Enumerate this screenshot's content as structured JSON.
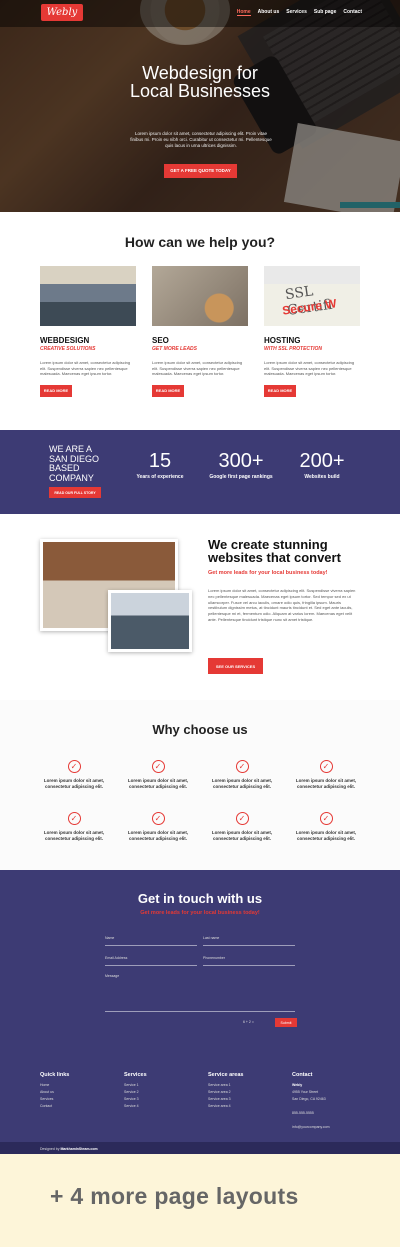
{
  "nav": {
    "logo": "Webly",
    "items": [
      "Home",
      "About us",
      "Services",
      "Sub page",
      "Contact"
    ]
  },
  "hero": {
    "title": "Webdesign for Local Businesses",
    "text": "Lorem ipsum dolor sit amet, consectetur adipiscing elit. Proin vitae finibus mi. Proin eu nibh orci. Curabitur ut consectetur mi. Pellentesque quis lacus in urna ultrices dignissim.",
    "button": "GET A FREE QUOTE TODAY"
  },
  "help": {
    "title": "How can we help you?",
    "cards": [
      {
        "title": "WEBDESIGN",
        "sub": "CREATIVE SOLUTIONS",
        "text": "Lorem ipsum dolor sit amet, consectetur adipiscing elit. Suspendisse viverra sapien nec pellentesque malesuada. Maecenas eget ipsum tortor.",
        "button": "READ MORE"
      },
      {
        "title": "SEO",
        "sub": "GET MORE LEADS",
        "text": "Lorem ipsum dolor sit amet, consectetur adipiscing elit. Suspendisse viverra sapien nec pellentesque malesuada. Maecenas eget ipsum tortor.",
        "button": "READ MORE"
      },
      {
        "title": "HOSTING",
        "sub": "WITH SSL PROTECTION",
        "text": "Lorem ipsum dolor sit amet, consectetur adipiscing elit. Suspendisse viverra sapien nec pellentesque malesuada. Maecenas eget ipsum tortor.",
        "button": "READ MORE"
      }
    ],
    "ssl_word": "SSL Certifi",
    "secure_word": "Secure W"
  },
  "stats": {
    "company": "WE ARE A SAN DIEGO BASED COMPANY",
    "button": "READ OUR FULL STORY",
    "items": [
      {
        "num": "15",
        "label": "Years of experience"
      },
      {
        "num": "300+",
        "label": "Google first page rankings"
      },
      {
        "num": "200+",
        "label": "Websites build"
      }
    ]
  },
  "stunning": {
    "title": "We create stunning websites that convert",
    "sub": "Get more leads for your local business today!",
    "text": "Lorem ipsum dolor sit amet, consectetur adipiscing elit. Suspendisse viverra sapien nec pellentesque malesuada. Maecenas eget ipsum tortor. Sed tempor sed ex ut ullamcorper. Fusce vel arcu iaculis, ornare odio quis, fringilla ipsum. Mauris vestibulum dignissim metus, at tincidunt mauris tincidunt et. Sed eget ante iaculis, pellentesque mi et, fermentum odio. Aliquam at varius lorem. Maecenas eget velit ante. Pellentesque tincidunt tristique nunc sit amet tristique.",
    "button": "SEE OUR SERVICES"
  },
  "why": {
    "title": "Why choose us",
    "item_text": "Lorem ipsum dolor sit amet, consectetur adipiscing elit.",
    "check": "✓"
  },
  "contact": {
    "title": "Get in touch with us",
    "sub": "Get more leads for your local business today!",
    "fields": {
      "name": "Name",
      "last_name": "Last name",
      "email": "Email Address",
      "phone": "Phonenumber",
      "message": "Message"
    },
    "captcha": "6 + 2 =",
    "submit": "Submit"
  },
  "footer": {
    "quick_links": {
      "title": "Quick links",
      "items": [
        "Home",
        "About us",
        "Services",
        "Contact"
      ]
    },
    "services": {
      "title": "Services",
      "items": [
        "Service 1",
        "Service 2",
        "Service 3",
        "Service 4"
      ]
    },
    "areas": {
      "title": "Service areas",
      "items": [
        "Service area 1",
        "Service area 2",
        "Service area 3",
        "Service area 4"
      ]
    },
    "contact": {
      "title": "Contact",
      "items": [
        "Webly",
        "4955 Your Street",
        "San Diego, CA 92463",
        "",
        "855-555-5555",
        "",
        "info@yourcompany.com"
      ]
    },
    "credit_prefix": "Designed by",
    "credit_name": "MarkhamInSteam.com"
  },
  "promo": {
    "text": "+ 4 more page layouts"
  },
  "colors": {
    "accent": "#e53935",
    "navy": "#3d3b74",
    "promo_bg": "#fdf5d9"
  }
}
